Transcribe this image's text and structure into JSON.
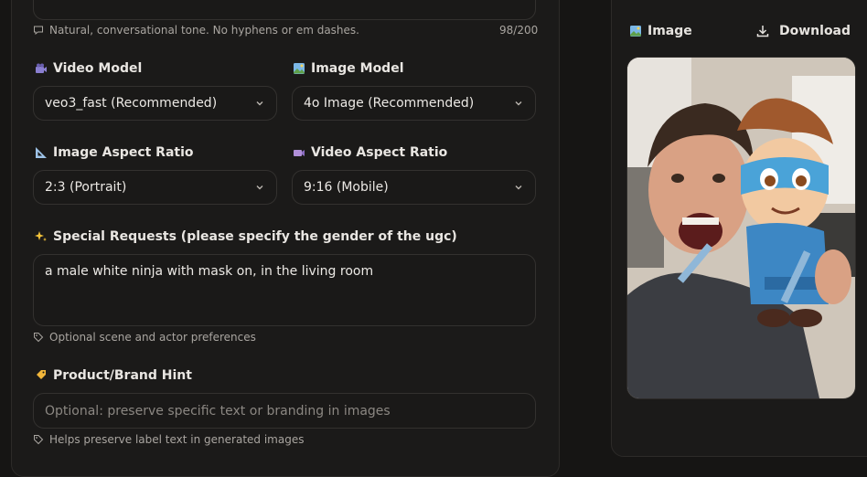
{
  "prompt_field": {
    "hint": "Natural, conversational tone. No hyphens or em dashes.",
    "counter": "98/200"
  },
  "video_model": {
    "label": "Video Model",
    "value": "veo3_fast (Recommended)",
    "icon": "film-camera-icon"
  },
  "image_model": {
    "label": "Image Model",
    "value": "4o Image (Recommended)",
    "icon": "picture-icon"
  },
  "image_aspect_ratio": {
    "label": "Image Aspect Ratio",
    "value": "2:3 (Portrait)",
    "icon": "triangle-ruler-icon"
  },
  "video_aspect_ratio": {
    "label": "Video Aspect Ratio",
    "value": "9:16 (Mobile)",
    "icon": "video-camera-icon"
  },
  "special_requests": {
    "label": "Special Requests (please specify the gender of the ugc)",
    "value": "a male white ninja with mask on, in the living room",
    "hint": "Optional scene and actor preferences",
    "icon": "sparkles-icon"
  },
  "product_brand_hint": {
    "label": "Product/Brand Hint",
    "placeholder": "Optional: preserve specific text or branding in images",
    "hint": "Helps preserve label text in generated images",
    "icon": "tag-icon"
  },
  "image_panel": {
    "title": "Image",
    "download_label": "Download"
  },
  "colors": {
    "background": "#161514",
    "panel": "#1b1a19",
    "border": "#33312f",
    "text": "#e6e3df",
    "muted": "#a9a5a0"
  }
}
